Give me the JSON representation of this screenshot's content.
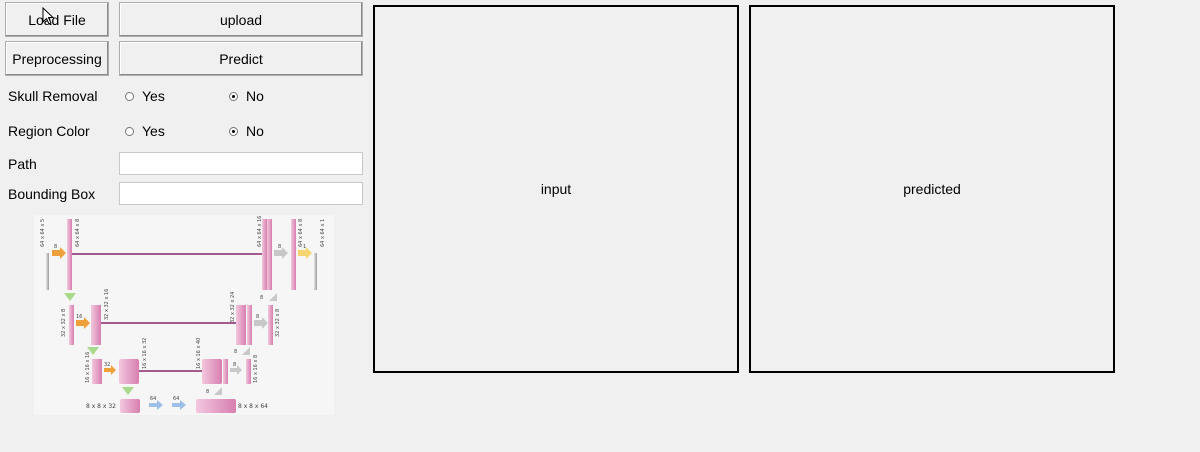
{
  "buttons": {
    "load_file": "Load File",
    "upload": "upload",
    "preprocessing": "Preprocessing",
    "predict": "Predict"
  },
  "options": {
    "skull_removal": {
      "label": "Skull Removal",
      "yes": "Yes",
      "no": "No",
      "selected": "No"
    },
    "region_color": {
      "label": "Region Color",
      "yes": "Yes",
      "no": "No",
      "selected": "No"
    }
  },
  "fields": {
    "path": {
      "label": "Path",
      "value": ""
    },
    "bounding_box": {
      "label": "Bounding Box",
      "value": ""
    }
  },
  "panels": {
    "input": "input",
    "predicted": "predicted"
  },
  "diagram": {
    "labels": {
      "l1a": "64 x 64 x 5",
      "l1b": "64 x 64 x 8",
      "c1": "8",
      "r1a": "64 x 64 x 16",
      "r1b": "64 x 64 x 8",
      "r1c": "64 x 64 x 1",
      "rc1": "8",
      "rc1b": "1",
      "l2a": "32 x 32 x 8",
      "l2b": "32 x 32 x 16",
      "c2": "16",
      "r2a": "32 x 32 x 24",
      "r2b": "32 x 32 x 8",
      "rc2": "8",
      "up1": "8",
      "l3a": "16 x 16 x 16",
      "l3b": "16 x 16 x 32",
      "c3": "32",
      "r3a": "16 x 16 x 40",
      "r3b": "16 x 16 x 8",
      "rc3": "8",
      "up2": "8",
      "b1": "8 x 8 x 32",
      "b2": "8 x 8 x 64",
      "bc1": "64",
      "bc2": "64",
      "up3": "8"
    }
  }
}
